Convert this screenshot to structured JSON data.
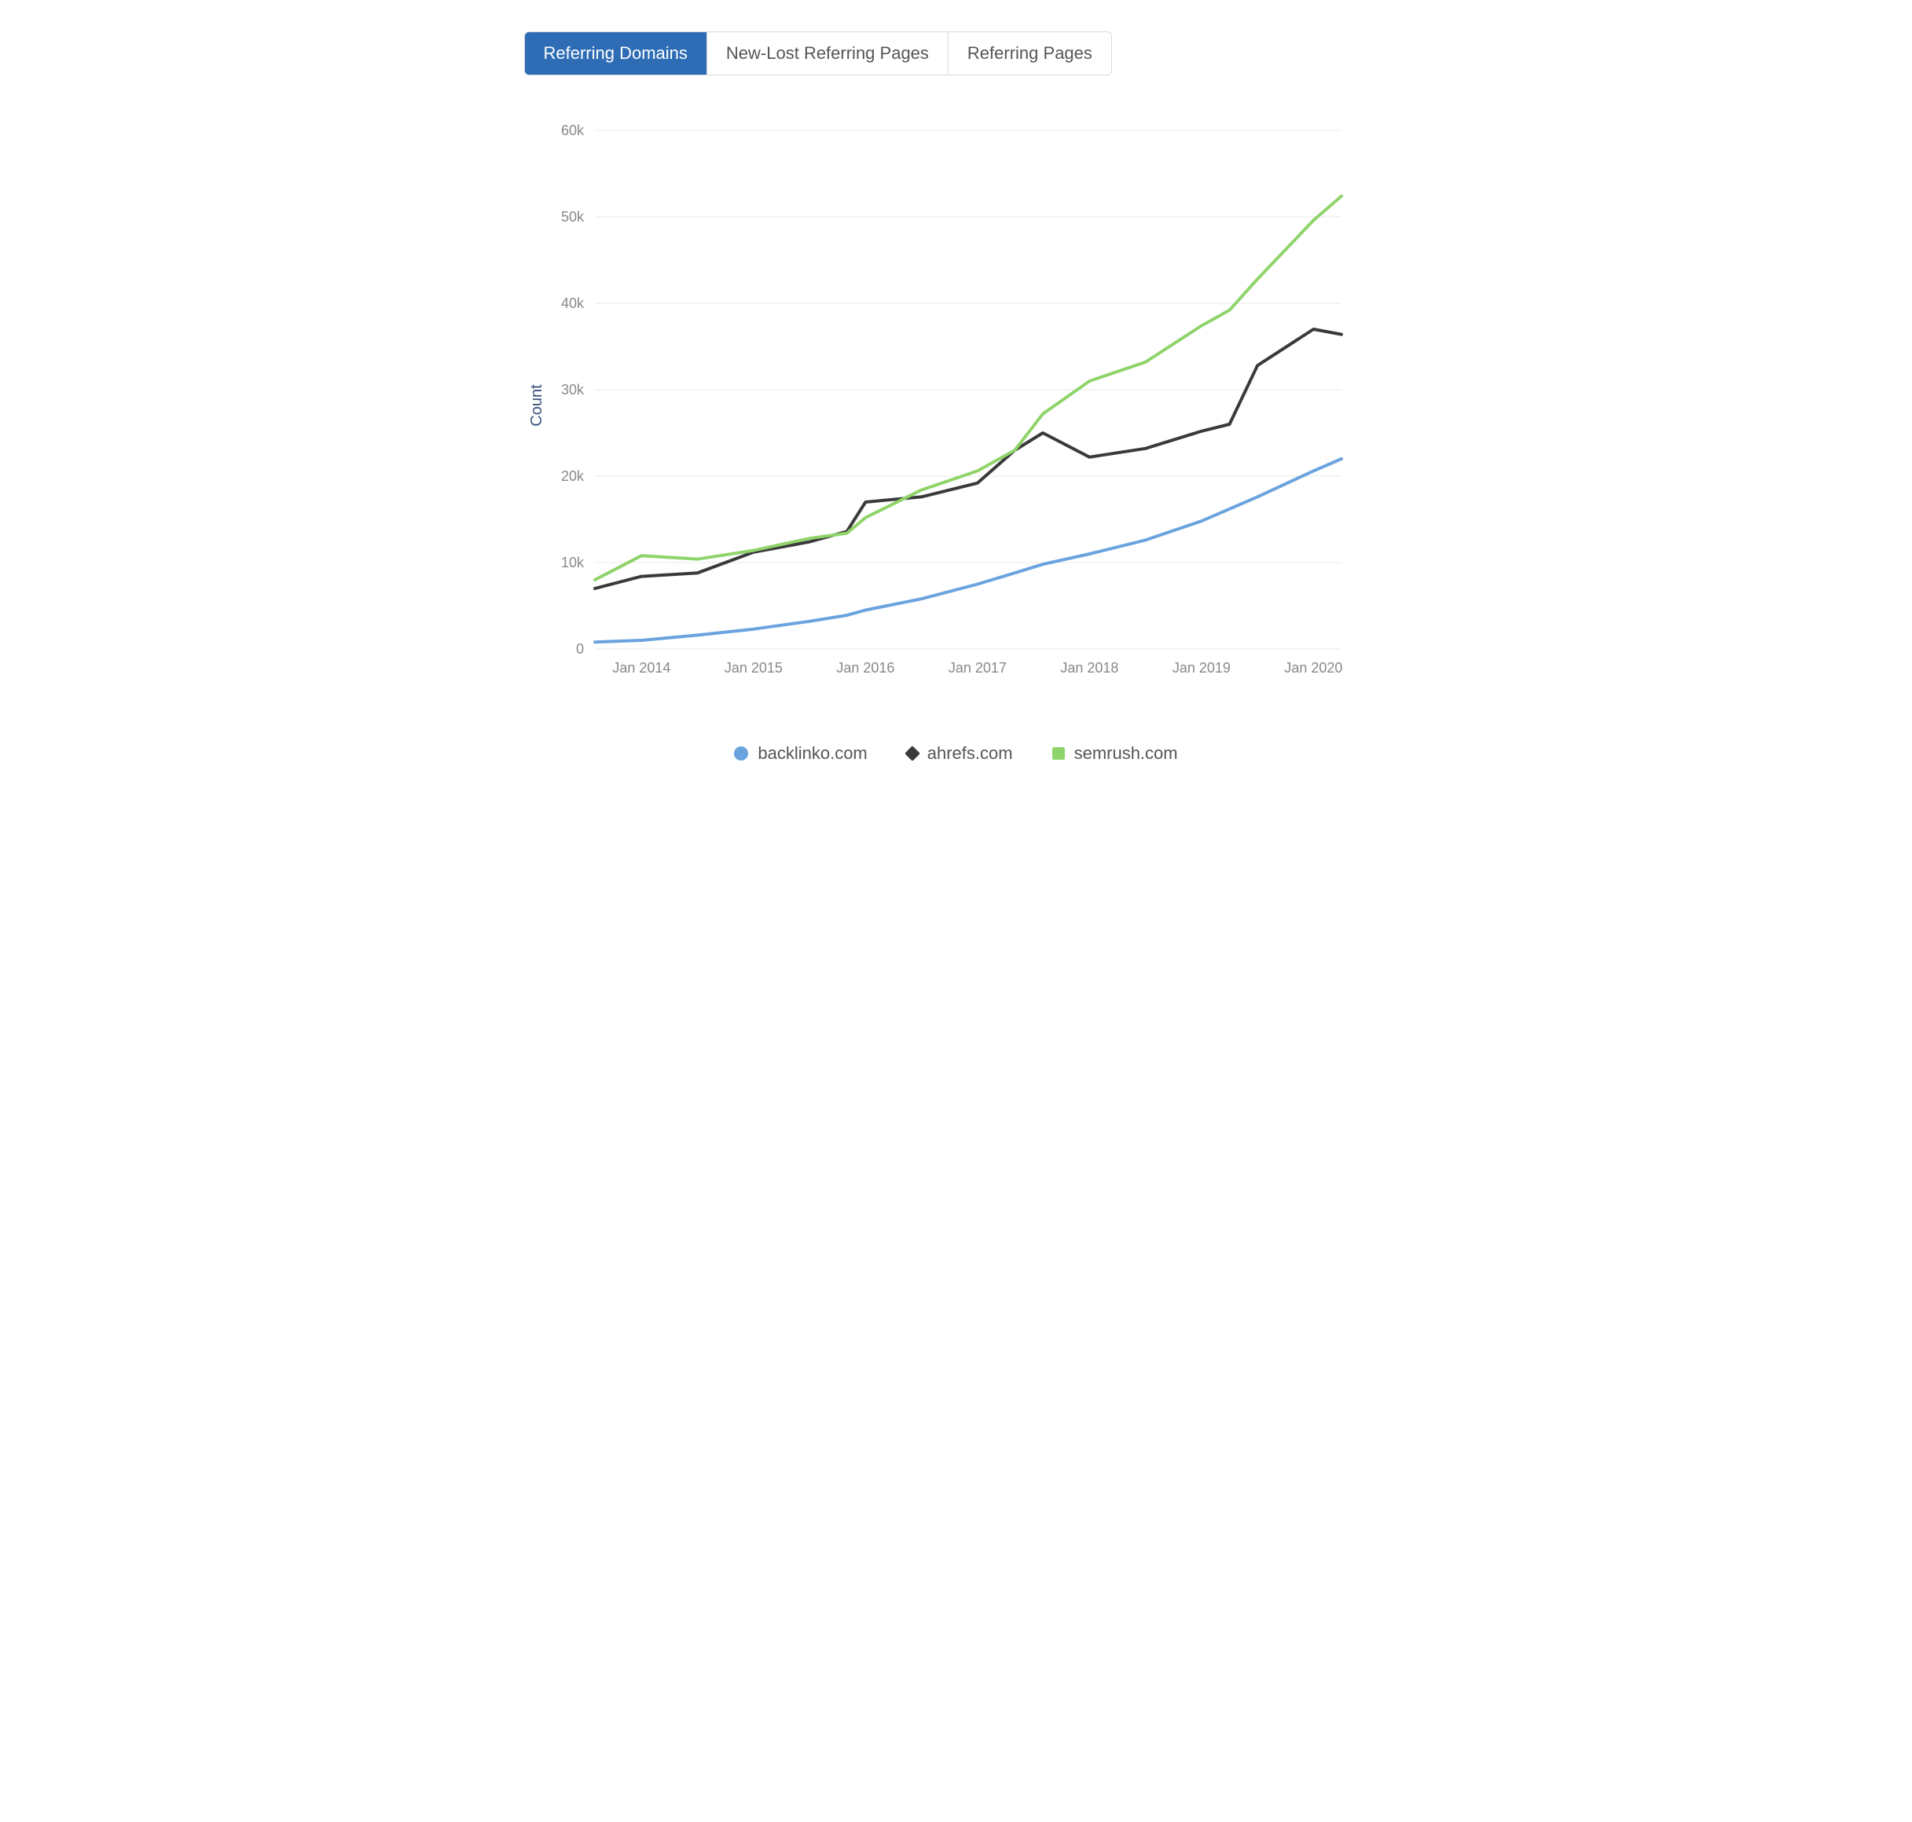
{
  "tabs": [
    {
      "label": "Referring Domains",
      "active": true
    },
    {
      "label": "New-Lost Referring Pages",
      "active": false
    },
    {
      "label": "Referring Pages",
      "active": false
    }
  ],
  "chart_data": {
    "type": "line",
    "ylabel": "Count",
    "ylim": [
      0,
      60000
    ],
    "yticks": [
      0,
      10000,
      20000,
      30000,
      40000,
      50000,
      60000
    ],
    "ytick_labels": [
      "0",
      "10k",
      "20k",
      "30k",
      "40k",
      "50k",
      "60k"
    ],
    "x": [
      "2013-08",
      "2014-01",
      "2014-07",
      "2015-01",
      "2015-07",
      "2015-11",
      "2016-01",
      "2016-07",
      "2017-01",
      "2017-05",
      "2017-08",
      "2018-01",
      "2018-07",
      "2019-01",
      "2019-04",
      "2019-07",
      "2020-01",
      "2020-04"
    ],
    "x_ticks": [
      "Jan 2014",
      "Jan 2015",
      "Jan 2016",
      "Jan 2017",
      "Jan 2018",
      "Jan 2019",
      "Jan 2020"
    ],
    "x_tick_positions": [
      "2014-01",
      "2015-01",
      "2016-01",
      "2017-01",
      "2018-01",
      "2019-01",
      "2020-01"
    ],
    "series": [
      {
        "name": "backlinko.com",
        "color": "#6aa3de",
        "marker": "circle",
        "values": [
          800,
          1000,
          1600,
          2300,
          3200,
          3900,
          4500,
          5800,
          7500,
          8800,
          9800,
          11000,
          12600,
          14800,
          16200,
          17600,
          20600,
          22000
        ]
      },
      {
        "name": "ahrefs.com",
        "color": "#3a3a3a",
        "marker": "diamond",
        "values": [
          7000,
          8400,
          8800,
          11200,
          12400,
          13600,
          17000,
          17600,
          19200,
          23000,
          25000,
          22200,
          23200,
          25200,
          26000,
          32800,
          37000,
          36400
        ]
      },
      {
        "name": "semrush.com",
        "color": "#8fd46a",
        "marker": "square",
        "values": [
          8000,
          10800,
          10400,
          11400,
          12800,
          13400,
          15200,
          18400,
          20600,
          23000,
          27200,
          31000,
          33200,
          37400,
          39200,
          42800,
          49600,
          52400
        ]
      }
    ]
  }
}
